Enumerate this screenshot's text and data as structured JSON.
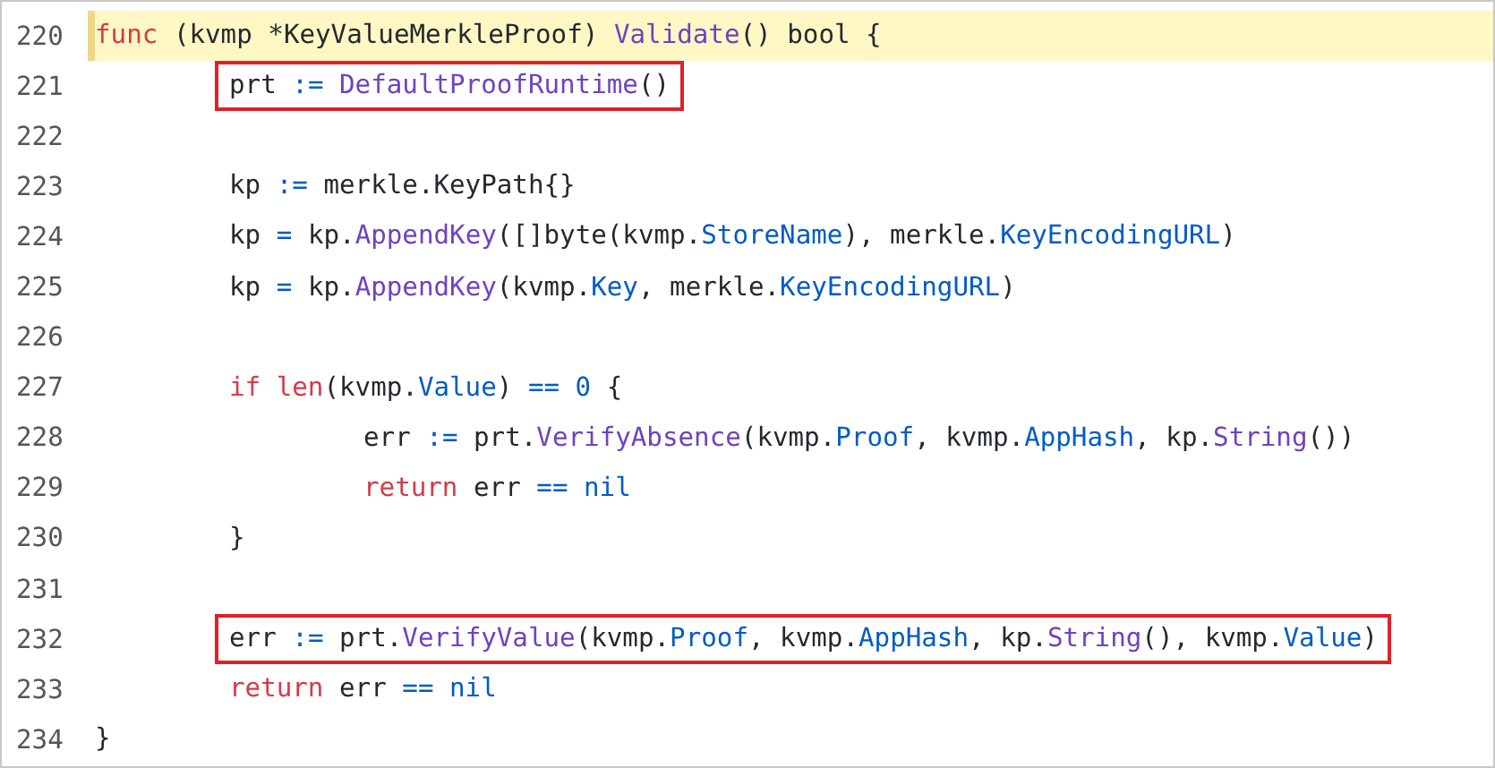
{
  "lines": [
    {
      "number": "220",
      "highlighted": true,
      "boxed": false,
      "tokens": [
        {
          "kind": "keyword",
          "text": "func"
        },
        {
          "kind": "plain",
          "text": " (kvmp *KeyValueMerkleProof) "
        },
        {
          "kind": "func",
          "text": "Validate"
        },
        {
          "kind": "plain",
          "text": "() bool {"
        }
      ]
    },
    {
      "number": "221",
      "highlighted": false,
      "boxed": true,
      "tokens": [
        {
          "kind": "plain",
          "text": "\tprt "
        },
        {
          "kind": "op",
          "text": ":= "
        },
        {
          "kind": "func",
          "text": "DefaultProofRuntime"
        },
        {
          "kind": "plain",
          "text": "()"
        }
      ]
    },
    {
      "number": "222",
      "highlighted": false,
      "boxed": false
    },
    {
      "number": "223",
      "highlighted": false,
      "boxed": false,
      "tokens": [
        {
          "kind": "plain",
          "text": "\tkp "
        },
        {
          "kind": "op",
          "text": ":="
        },
        {
          "kind": "plain",
          "text": " merkle.KeyPath{}"
        }
      ]
    },
    {
      "number": "224",
      "highlighted": false,
      "boxed": false,
      "tokens": [
        {
          "kind": "plain",
          "text": "\tkp "
        },
        {
          "kind": "op",
          "text": "="
        },
        {
          "kind": "plain",
          "text": " kp."
        },
        {
          "kind": "func",
          "text": "AppendKey"
        },
        {
          "kind": "plain",
          "text": "([]byte(kvmp."
        },
        {
          "kind": "field",
          "text": "StoreName"
        },
        {
          "kind": "plain",
          "text": "), merkle."
        },
        {
          "kind": "field",
          "text": "KeyEncodingURL"
        },
        {
          "kind": "plain",
          "text": ")"
        }
      ]
    },
    {
      "number": "225",
      "highlighted": false,
      "boxed": false,
      "tokens": [
        {
          "kind": "plain",
          "text": "\tkp "
        },
        {
          "kind": "op",
          "text": "="
        },
        {
          "kind": "plain",
          "text": " kp."
        },
        {
          "kind": "func",
          "text": "AppendKey"
        },
        {
          "kind": "plain",
          "text": "(kvmp."
        },
        {
          "kind": "field",
          "text": "Key"
        },
        {
          "kind": "plain",
          "text": ", merkle."
        },
        {
          "kind": "field",
          "text": "KeyEncodingURL"
        },
        {
          "kind": "plain",
          "text": ")"
        }
      ]
    },
    {
      "number": "226",
      "highlighted": false,
      "boxed": false
    },
    {
      "number": "227",
      "highlighted": false,
      "boxed": false,
      "tokens": [
        {
          "kind": "keyword",
          "text": "\tif len"
        },
        {
          "kind": "plain",
          "text": "(kvmp."
        },
        {
          "kind": "field",
          "text": "Value"
        },
        {
          "kind": "plain",
          "text": ") "
        },
        {
          "kind": "op",
          "text": "== 0"
        },
        {
          "kind": "plain",
          "text": " {"
        }
      ]
    },
    {
      "number": "228",
      "highlighted": false,
      "boxed": false,
      "tokens": [
        {
          "kind": "plain",
          "text": "\t\terr "
        },
        {
          "kind": "op",
          "text": ":="
        },
        {
          "kind": "plain",
          "text": " prt."
        },
        {
          "kind": "func",
          "text": "VerifyAbsence"
        },
        {
          "kind": "plain",
          "text": "(kvmp."
        },
        {
          "kind": "field",
          "text": "Proof"
        },
        {
          "kind": "plain",
          "text": ", kvmp."
        },
        {
          "kind": "field",
          "text": "AppHash"
        },
        {
          "kind": "plain",
          "text": ", kp."
        },
        {
          "kind": "func",
          "text": "String"
        },
        {
          "kind": "plain",
          "text": "())"
        }
      ]
    },
    {
      "number": "229",
      "highlighted": false,
      "boxed": false,
      "tokens": [
        {
          "kind": "keyword",
          "text": "\t\treturn"
        },
        {
          "kind": "plain",
          "text": " err "
        },
        {
          "kind": "op",
          "text": "== nil"
        }
      ]
    },
    {
      "number": "230",
      "highlighted": false,
      "boxed": false,
      "tokens": [
        {
          "kind": "plain",
          "text": "\t}"
        }
      ]
    },
    {
      "number": "231",
      "highlighted": false,
      "boxed": false
    },
    {
      "number": "232",
      "highlighted": false,
      "boxed": true,
      "tokens": [
        {
          "kind": "plain",
          "text": "\terr "
        },
        {
          "kind": "op",
          "text": ":="
        },
        {
          "kind": "plain",
          "text": " prt."
        },
        {
          "kind": "func",
          "text": "VerifyValue"
        },
        {
          "kind": "plain",
          "text": "(kvmp."
        },
        {
          "kind": "field",
          "text": "Proof"
        },
        {
          "kind": "plain",
          "text": ", kvmp."
        },
        {
          "kind": "field",
          "text": "AppHash"
        },
        {
          "kind": "plain",
          "text": ", kp."
        },
        {
          "kind": "func",
          "text": "String"
        },
        {
          "kind": "plain",
          "text": "(), kvmp."
        },
        {
          "kind": "field",
          "text": "Value"
        },
        {
          "kind": "plain",
          "text": ")"
        }
      ]
    },
    {
      "number": "233",
      "highlighted": false,
      "boxed": false,
      "tokens": [
        {
          "kind": "keyword",
          "text": "\treturn"
        },
        {
          "kind": "plain",
          "text": " err "
        },
        {
          "kind": "op",
          "text": "== nil"
        }
      ]
    },
    {
      "number": "234",
      "highlighted": false,
      "boxed": false,
      "tokens": [
        {
          "kind": "plain",
          "text": "}"
        }
      ]
    }
  ]
}
